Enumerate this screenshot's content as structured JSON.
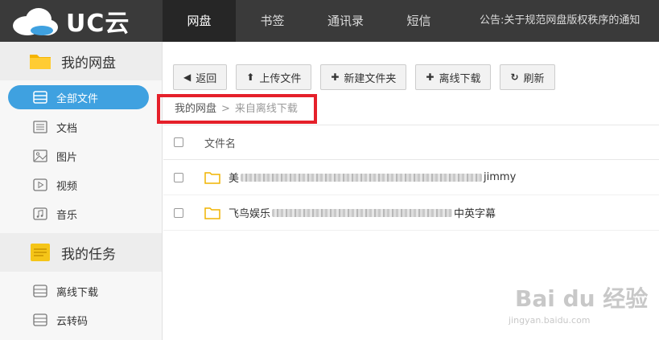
{
  "app": {
    "logo_text": "UC云"
  },
  "nav": {
    "items": [
      {
        "label": "网盘"
      },
      {
        "label": "书签"
      },
      {
        "label": "通讯录"
      },
      {
        "label": "短信"
      }
    ],
    "notice": "公告:关于规范网盘版权秩序的通知"
  },
  "sidebar": {
    "disk_title": "我的网盘",
    "disk_items": [
      {
        "label": "全部文件"
      },
      {
        "label": "文档"
      },
      {
        "label": "图片"
      },
      {
        "label": "视频"
      },
      {
        "label": "音乐"
      }
    ],
    "task_title": "我的任务",
    "task_items": [
      {
        "label": "离线下载"
      },
      {
        "label": "云转码"
      }
    ]
  },
  "toolbar": {
    "back": "返回",
    "upload": "上传文件",
    "new_folder": "新建文件夹",
    "offline": "离线下载",
    "refresh": "刷新"
  },
  "breadcrumb": {
    "root": "我的网盘",
    "sep": ">",
    "current": "来自离线下载"
  },
  "table": {
    "header_name": "文件名",
    "rows": [
      {
        "prefix": "美",
        "suffix": "jimmy"
      },
      {
        "prefix": "飞鸟娱乐",
        "suffix": "中英字幕"
      }
    ]
  },
  "watermark": {
    "text": "Bai du 经验",
    "url": "jingyan.baidu.com"
  }
}
